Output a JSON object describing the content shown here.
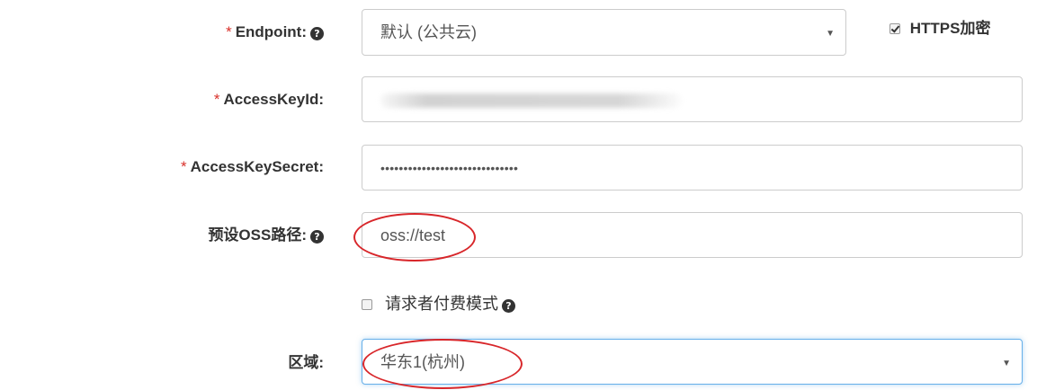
{
  "form": {
    "endpoint": {
      "required_mark": "*",
      "label": "Endpoint:",
      "help_icon": "question-circle-icon",
      "selected": "默认 (公共云)"
    },
    "https": {
      "checked": true,
      "label": "HTTPS加密"
    },
    "access_key_id": {
      "required_mark": "*",
      "label": "AccessKeyId:",
      "value": ""
    },
    "access_key_secret": {
      "required_mark": "*",
      "label": "AccessKeySecret:",
      "value": "••••••••••••••••••••••••••••••"
    },
    "oss_path": {
      "label": "预设OSS路径:",
      "help_icon": "question-circle-icon",
      "value": "oss://test"
    },
    "requester_pays": {
      "checked": false,
      "label": "请求者付费模式",
      "help_icon": "question-circle-icon"
    },
    "region": {
      "label": "区域:",
      "selected": "华东1(杭州)"
    }
  },
  "annotation_color": "#d8262a",
  "focus_color": "#66afe9"
}
